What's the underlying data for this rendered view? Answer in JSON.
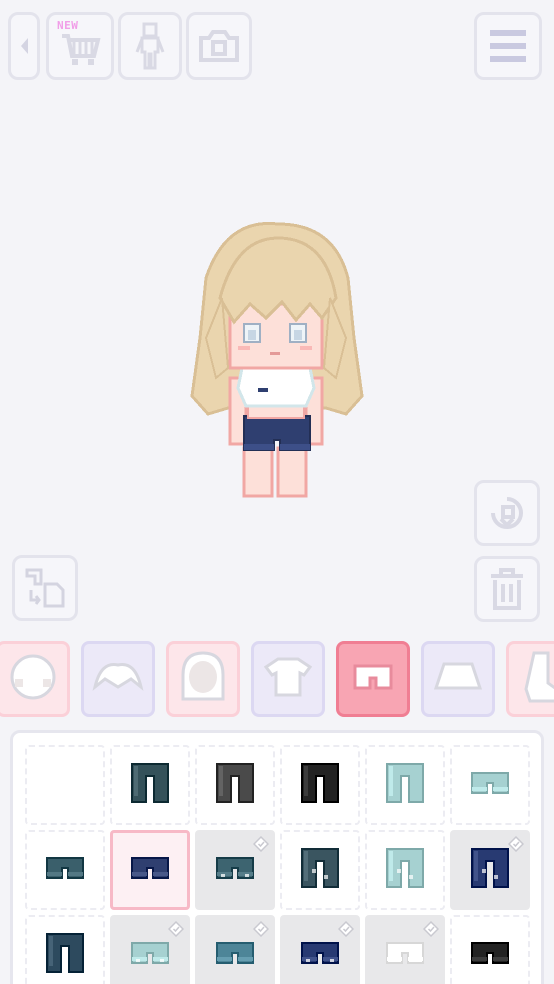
{
  "toolbar": {
    "back": "back-arrow-icon",
    "shop_new_label": "NEW",
    "shop": "cart-icon",
    "body": "body-silhouette-icon",
    "camera": "camera-icon",
    "menu": "hamburger-menu-icon"
  },
  "side_buttons": {
    "swap": "swap-outfit-icon",
    "rotate": "rotate-icon",
    "trash": "trash-icon"
  },
  "categories": [
    {
      "icon": "face-icon",
      "style": "pink"
    },
    {
      "icon": "bangs-icon",
      "style": "lav"
    },
    {
      "icon": "hair-back-icon",
      "style": "pink"
    },
    {
      "icon": "top-icon",
      "style": "lav"
    },
    {
      "icon": "shorts-icon",
      "style": "selected"
    },
    {
      "icon": "skirt-icon",
      "style": "lav"
    },
    {
      "icon": "shoes-icon",
      "style": "pink"
    }
  ],
  "items": [
    [
      {
        "kind": "empty",
        "color": "",
        "locked": false
      },
      {
        "kind": "pants",
        "color": "#35525a",
        "locked": false
      },
      {
        "kind": "pants",
        "color": "#4a4a4a",
        "locked": false
      },
      {
        "kind": "pants",
        "color": "#232323",
        "locked": false
      },
      {
        "kind": "pants",
        "color": "#a6d1d1",
        "locked": false
      },
      {
        "kind": "shorts",
        "color": "#a6d1d1",
        "locked": false
      }
    ],
    [
      {
        "kind": "shorts",
        "color": "#3a5f6b",
        "locked": false
      },
      {
        "kind": "shorts",
        "color": "#2f3f70",
        "locked": false,
        "selected": true
      },
      {
        "kind": "shorts-ripped",
        "color": "#3d6470",
        "locked": true
      },
      {
        "kind": "pants-ripped",
        "color": "#3a5560",
        "locked": false
      },
      {
        "kind": "pants-ripped",
        "color": "#a6d1d1",
        "locked": false
      },
      {
        "kind": "pants-ripped",
        "color": "#283a72",
        "locked": true
      }
    ],
    [
      {
        "kind": "pants",
        "color": "#2d4a5e",
        "locked": false
      },
      {
        "kind": "shorts-ripped",
        "color": "#a6d1d1",
        "locked": true
      },
      {
        "kind": "shorts",
        "color": "#4d8598",
        "locked": true
      },
      {
        "kind": "shorts-ripped",
        "color": "#283a72",
        "locked": true
      },
      {
        "kind": "shorts-ripped",
        "color": "#ffffff",
        "locked": true
      },
      {
        "kind": "shorts",
        "color": "#232323",
        "locked": false
      }
    ]
  ],
  "avatar": {
    "hair": "#ead5ae",
    "skin": "#fde0d9",
    "top": "#ffffff",
    "shorts": "#2f3f70"
  }
}
